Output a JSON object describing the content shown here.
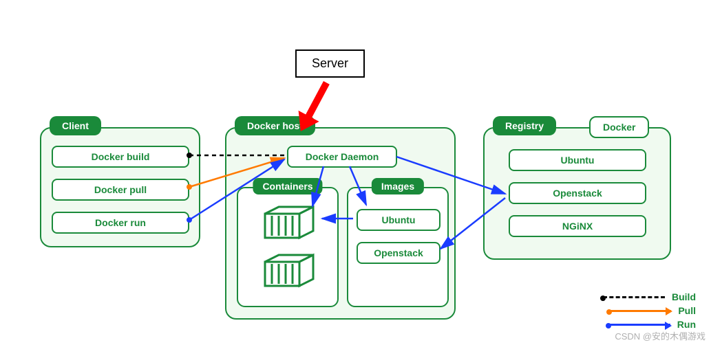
{
  "annotation": {
    "label": "Server"
  },
  "client": {
    "title": "Client",
    "commands": [
      "Docker build",
      "Docker pull",
      "Docker run"
    ]
  },
  "host": {
    "title": "Docker host",
    "daemon": "Docker Daemon",
    "containers": {
      "title": "Containers"
    },
    "images": {
      "title": "Images",
      "items": [
        "Ubuntu",
        "Openstack"
      ]
    }
  },
  "registry": {
    "title": "Registry",
    "subtitle": "Docker",
    "items": [
      "Ubuntu",
      "Openstack",
      "NGiNX"
    ]
  },
  "legend": {
    "build": "Build",
    "pull": "Pull",
    "run": "Run"
  },
  "watermark": "CSDN @安的木偶游戏",
  "colors": {
    "green": "#1a8a3a",
    "orange": "#ff7a00",
    "blue": "#1a3cff",
    "black": "#000000",
    "red": "#ff0000"
  }
}
